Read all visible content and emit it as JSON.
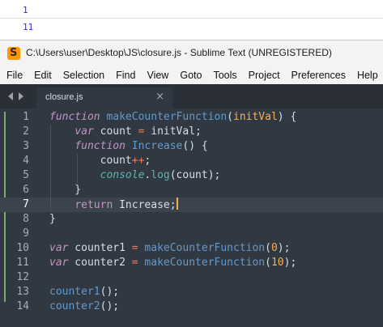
{
  "console": {
    "lines": [
      "1",
      "11"
    ]
  },
  "window": {
    "title": "C:\\Users\\user\\Desktop\\JS\\closure.js - Sublime Text (UNREGISTERED)",
    "app_icon_letter": "S"
  },
  "menu": [
    "File",
    "Edit",
    "Selection",
    "Find",
    "View",
    "Goto",
    "Tools",
    "Project",
    "Preferences",
    "Help"
  ],
  "tabs": [
    {
      "label": "closure.js",
      "close_glyph": "×",
      "active": true
    }
  ],
  "editor": {
    "active_line": 7,
    "line_numbers": [
      "1",
      "2",
      "3",
      "4",
      "5",
      "6",
      "7",
      "8",
      "9",
      "10",
      "11",
      "12",
      "13",
      "14"
    ],
    "lines": [
      [
        [
          "kw",
          "function"
        ],
        [
          "pl",
          " "
        ],
        [
          "fn",
          "makeCounterFunction"
        ],
        [
          "pl",
          "("
        ],
        [
          "param",
          "initVal"
        ],
        [
          "pl",
          ") {"
        ]
      ],
      [
        [
          "pl",
          "    "
        ],
        [
          "kw",
          "var"
        ],
        [
          "pl",
          " count "
        ],
        [
          "op",
          "="
        ],
        [
          "pl",
          " initVal;"
        ]
      ],
      [
        [
          "pl",
          "    "
        ],
        [
          "kw",
          "function"
        ],
        [
          "pl",
          " "
        ],
        [
          "fn",
          "Increase"
        ],
        [
          "pl",
          "() {"
        ]
      ],
      [
        [
          "pl",
          "        count"
        ],
        [
          "op",
          "++"
        ],
        [
          "pl",
          ";"
        ]
      ],
      [
        [
          "pl",
          "        "
        ],
        [
          "obj",
          "console"
        ],
        [
          "pl",
          "."
        ],
        [
          "meth",
          "log"
        ],
        [
          "pl",
          "(count);"
        ]
      ],
      [
        [
          "pl",
          "    }"
        ]
      ],
      [
        [
          "pl",
          "    "
        ],
        [
          "ret",
          "return"
        ],
        [
          "pl",
          " Increase;"
        ]
      ],
      [
        [
          "pl",
          "}"
        ]
      ],
      [],
      [
        [
          "kw",
          "var"
        ],
        [
          "pl",
          " counter1 "
        ],
        [
          "op",
          "="
        ],
        [
          "pl",
          " "
        ],
        [
          "fn",
          "makeCounterFunction"
        ],
        [
          "pl",
          "("
        ],
        [
          "num",
          "0"
        ],
        [
          "pl",
          ");"
        ]
      ],
      [
        [
          "kw",
          "var"
        ],
        [
          "pl",
          " counter2 "
        ],
        [
          "op",
          "="
        ],
        [
          "pl",
          " "
        ],
        [
          "fn",
          "makeCounterFunction"
        ],
        [
          "pl",
          "("
        ],
        [
          "num",
          "10"
        ],
        [
          "pl",
          ");"
        ]
      ],
      [],
      [
        [
          "fn",
          "counter1"
        ],
        [
          "pl",
          "();"
        ]
      ],
      [
        [
          "fn",
          "counter2"
        ],
        [
          "pl",
          "();"
        ]
      ]
    ]
  }
}
